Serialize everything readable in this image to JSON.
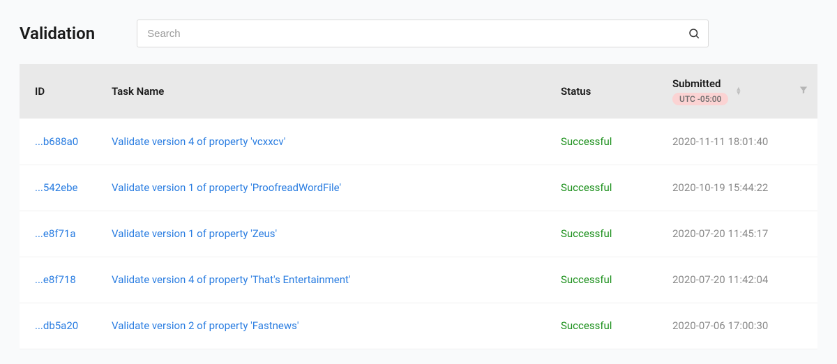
{
  "page": {
    "title": "Validation"
  },
  "search": {
    "placeholder": "Search"
  },
  "table": {
    "columns": {
      "id": "ID",
      "task_name": "Task Name",
      "status": "Status",
      "submitted": "Submitted",
      "timezone_badge": "UTC -05:00"
    },
    "rows": [
      {
        "id": "...b688a0",
        "task_name": "Validate version 4 of property 'vcxxcv'",
        "status": "Successful",
        "submitted": "2020-11-11 18:01:40"
      },
      {
        "id": "...542ebe",
        "task_name": "Validate version 1 of property 'ProofreadWordFile'",
        "status": "Successful",
        "submitted": "2020-10-19 15:44:22"
      },
      {
        "id": "...e8f71a",
        "task_name": "Validate version 1 of property 'Zeus'",
        "status": "Successful",
        "submitted": "2020-07-20 11:45:17"
      },
      {
        "id": "...e8f718",
        "task_name": "Validate version 4 of property 'That's Entertainment'",
        "status": "Successful",
        "submitted": "2020-07-20 11:42:04"
      },
      {
        "id": "...db5a20",
        "task_name": "Validate version 2 of property 'Fastnews'",
        "status": "Successful",
        "submitted": "2020-07-06 17:00:30"
      }
    ]
  }
}
